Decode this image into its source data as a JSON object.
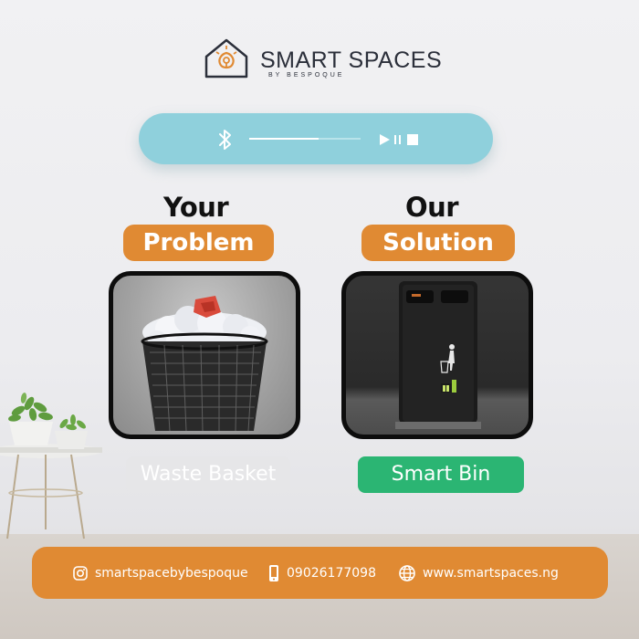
{
  "brand": {
    "name": "SMART SPACES",
    "tagline": "BY BESPOQUE"
  },
  "player": {
    "bluetooth_icon": "bluetooth-icon",
    "progress": 0.62,
    "controls_icon": "play-pause-stop-icon"
  },
  "problem": {
    "heading": "Your",
    "label": "Problem",
    "image": "waste-basket-photo",
    "caption": "Waste Basket"
  },
  "solution": {
    "heading": "Our",
    "label": "Solution",
    "image": "smart-bin-photo",
    "caption": "Smart Bin"
  },
  "footer": {
    "instagram_icon": "instagram-icon",
    "instagram": "smartspacebybespoque",
    "phone_icon": "phone-icon",
    "phone": "09026177098",
    "globe_icon": "globe-icon",
    "website": "www.smartspaces.ng"
  },
  "colors": {
    "orange": "#e08a33",
    "player_blue": "#8fd0dc",
    "green": "#2bb573",
    "dark": "#2b2f3a"
  }
}
